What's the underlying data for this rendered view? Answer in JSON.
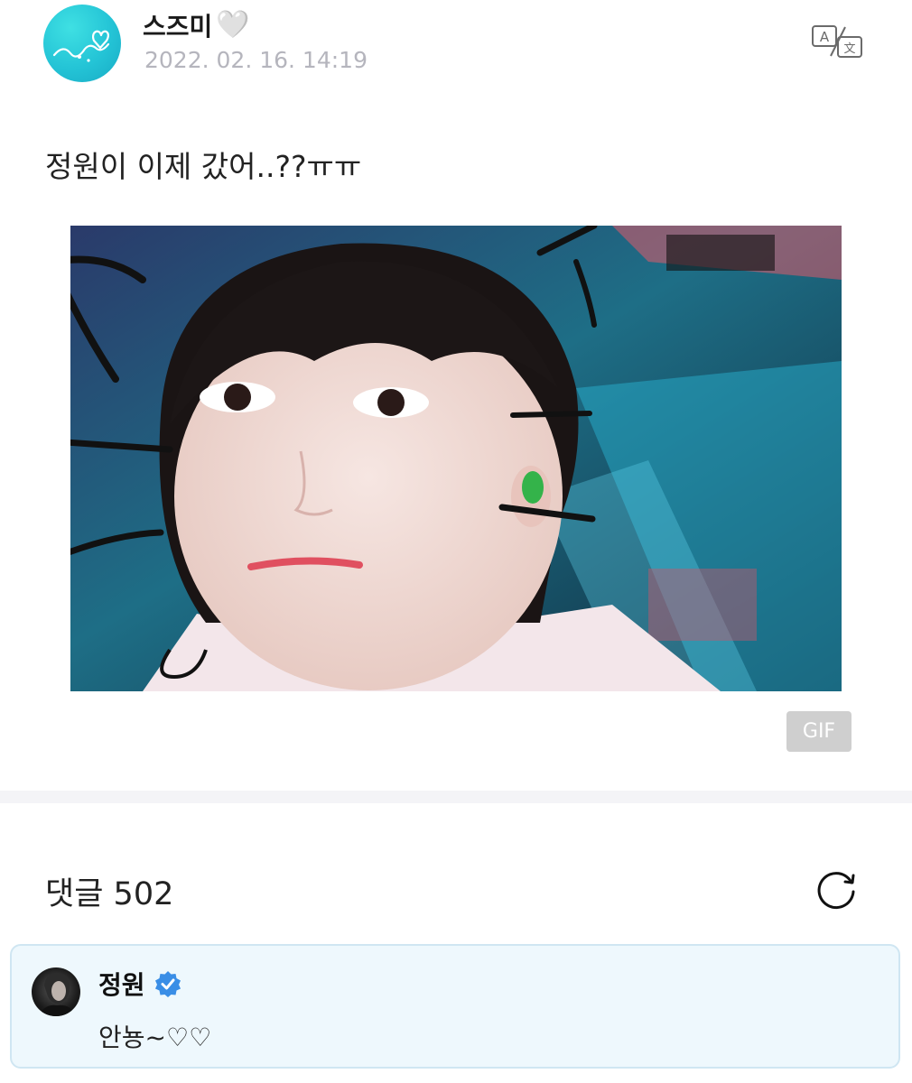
{
  "post": {
    "author": {
      "name": "스즈미",
      "name_suffix_icon": "white-heart-icon",
      "heart_glyph": "🤍"
    },
    "timestamp": "2022. 02. 16. 14:19",
    "translate_icon": "translate-icon",
    "text": "정원이 이제 갔어..??ㅠㅠ",
    "media": {
      "type": "gif",
      "badge_label": "GIF"
    }
  },
  "comments": {
    "label": "댓글",
    "count": "502",
    "refresh_icon": "refresh-icon",
    "items": [
      {
        "author": "정원",
        "verified": true,
        "text": "안뇽~♡♡"
      }
    ]
  },
  "colors": {
    "avatar": "#24c4d6",
    "verified": "#3a8ee6",
    "comment_bg": "#eef8fd",
    "comment_border": "#cfe6f2",
    "timestamp": "#b5b5bd"
  }
}
